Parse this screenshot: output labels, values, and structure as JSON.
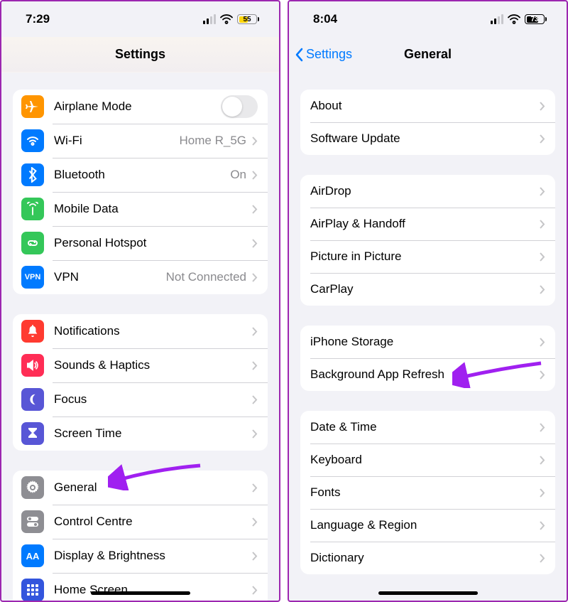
{
  "left": {
    "status": {
      "time": "7:29",
      "battery": "55"
    },
    "title": "Settings",
    "group1": [
      {
        "key": "airplane",
        "label": "Airplane Mode",
        "control": "toggle",
        "color": "#ff9500"
      },
      {
        "key": "wifi",
        "label": "Wi-Fi",
        "value": "Home R_5G",
        "color": "#007aff"
      },
      {
        "key": "bluetooth",
        "label": "Bluetooth",
        "value": "On",
        "color": "#007aff"
      },
      {
        "key": "mobile",
        "label": "Mobile Data",
        "color": "#34c759"
      },
      {
        "key": "hotspot",
        "label": "Personal Hotspot",
        "color": "#34c759"
      },
      {
        "key": "vpn",
        "label": "VPN",
        "value": "Not Connected",
        "color": "#007aff",
        "text": "VPN"
      }
    ],
    "group2": [
      {
        "key": "notifications",
        "label": "Notifications",
        "color": "#ff3b30"
      },
      {
        "key": "sounds",
        "label": "Sounds & Haptics",
        "color": "#ff2d55"
      },
      {
        "key": "focus",
        "label": "Focus",
        "color": "#5856d6"
      },
      {
        "key": "screentime",
        "label": "Screen Time",
        "color": "#5856d6"
      }
    ],
    "group3": [
      {
        "key": "general",
        "label": "General",
        "color": "#8e8e93"
      },
      {
        "key": "control",
        "label": "Control Centre",
        "color": "#8e8e93"
      },
      {
        "key": "display",
        "label": "Display & Brightness",
        "color": "#007aff",
        "text": "AA"
      },
      {
        "key": "home",
        "label": "Home Screen",
        "color": "#3355dd"
      }
    ]
  },
  "right": {
    "status": {
      "time": "8:04",
      "battery": "73"
    },
    "back": "Settings",
    "title": "General",
    "groups": [
      [
        "About",
        "Software Update"
      ],
      [
        "AirDrop",
        "AirPlay & Handoff",
        "Picture in Picture",
        "CarPlay"
      ],
      [
        "iPhone Storage",
        "Background App Refresh"
      ],
      [
        "Date & Time",
        "Keyboard",
        "Fonts",
        "Language & Region",
        "Dictionary"
      ]
    ]
  }
}
